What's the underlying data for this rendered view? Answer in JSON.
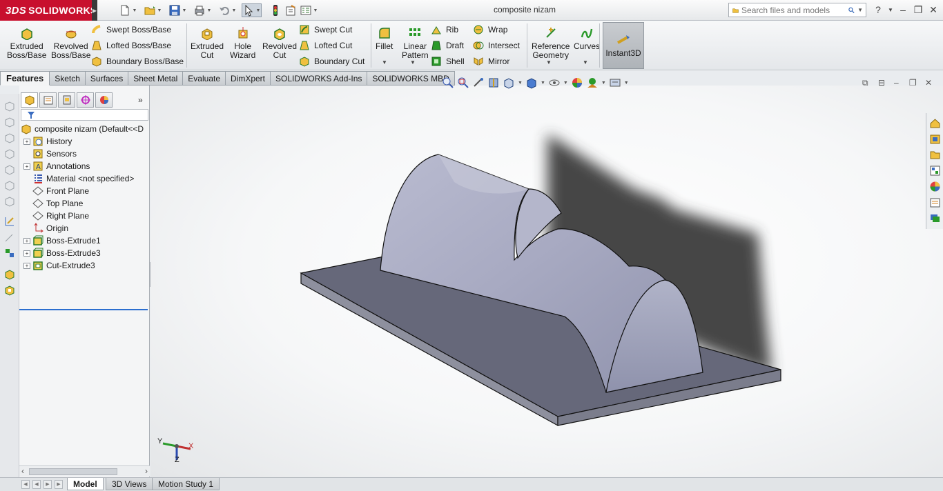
{
  "app": {
    "brand": "SOLIDWORKS",
    "document_title": "composite nizam"
  },
  "search": {
    "placeholder": "Search files and models"
  },
  "ribbon": {
    "extruded_boss": "Extruded\nBoss/Base",
    "revolved_boss": "Revolved\nBoss/Base",
    "swept_boss": "Swept Boss/Base",
    "lofted_boss": "Lofted Boss/Base",
    "boundary_boss": "Boundary Boss/Base",
    "extruded_cut": "Extruded\nCut",
    "hole_wizard": "Hole\nWizard",
    "revolved_cut": "Revolved\nCut",
    "swept_cut": "Swept Cut",
    "lofted_cut": "Lofted Cut",
    "boundary_cut": "Boundary Cut",
    "fillet": "Fillet",
    "linear_pattern": "Linear\nPattern",
    "rib": "Rib",
    "draft": "Draft",
    "shell": "Shell",
    "wrap": "Wrap",
    "intersect": "Intersect",
    "mirror": "Mirror",
    "reference_geometry": "Reference\nGeometry",
    "curves": "Curves",
    "instant3d": "Instant3D"
  },
  "command_tabs": [
    "Features",
    "Sketch",
    "Surfaces",
    "Sheet Metal",
    "Evaluate",
    "DimXpert",
    "SOLIDWORKS Add-Ins",
    "SOLIDWORKS MBD"
  ],
  "tree": {
    "root": "composite nizam  (Default<<D",
    "items": [
      {
        "label": "History",
        "expandable": true,
        "icon": "history-icon"
      },
      {
        "label": "Sensors",
        "expandable": false,
        "icon": "sensors-icon"
      },
      {
        "label": "Annotations",
        "expandable": true,
        "icon": "annotations-icon"
      },
      {
        "label": "Material <not specified>",
        "expandable": false,
        "icon": "material-icon"
      },
      {
        "label": "Front Plane",
        "expandable": false,
        "icon": "plane-icon"
      },
      {
        "label": "Top Plane",
        "expandable": false,
        "icon": "plane-icon"
      },
      {
        "label": "Right Plane",
        "expandable": false,
        "icon": "plane-icon"
      },
      {
        "label": "Origin",
        "expandable": false,
        "icon": "origin-icon"
      },
      {
        "label": "Boss-Extrude1",
        "expandable": true,
        "icon": "boss-extrude-icon"
      },
      {
        "label": "Boss-Extrude3",
        "expandable": true,
        "icon": "boss-extrude-icon"
      },
      {
        "label": "Cut-Extrude3",
        "expandable": true,
        "icon": "cut-extrude-icon"
      }
    ]
  },
  "triad": {
    "x": "X",
    "y": "Y",
    "z": "Z"
  },
  "bottom_tabs": [
    "Model",
    "3D Views",
    "Motion Study 1"
  ],
  "colors": {
    "brand_red": "#c8102e",
    "part_face": "#a6a9c2",
    "base_plate": "#6a6c7d"
  }
}
